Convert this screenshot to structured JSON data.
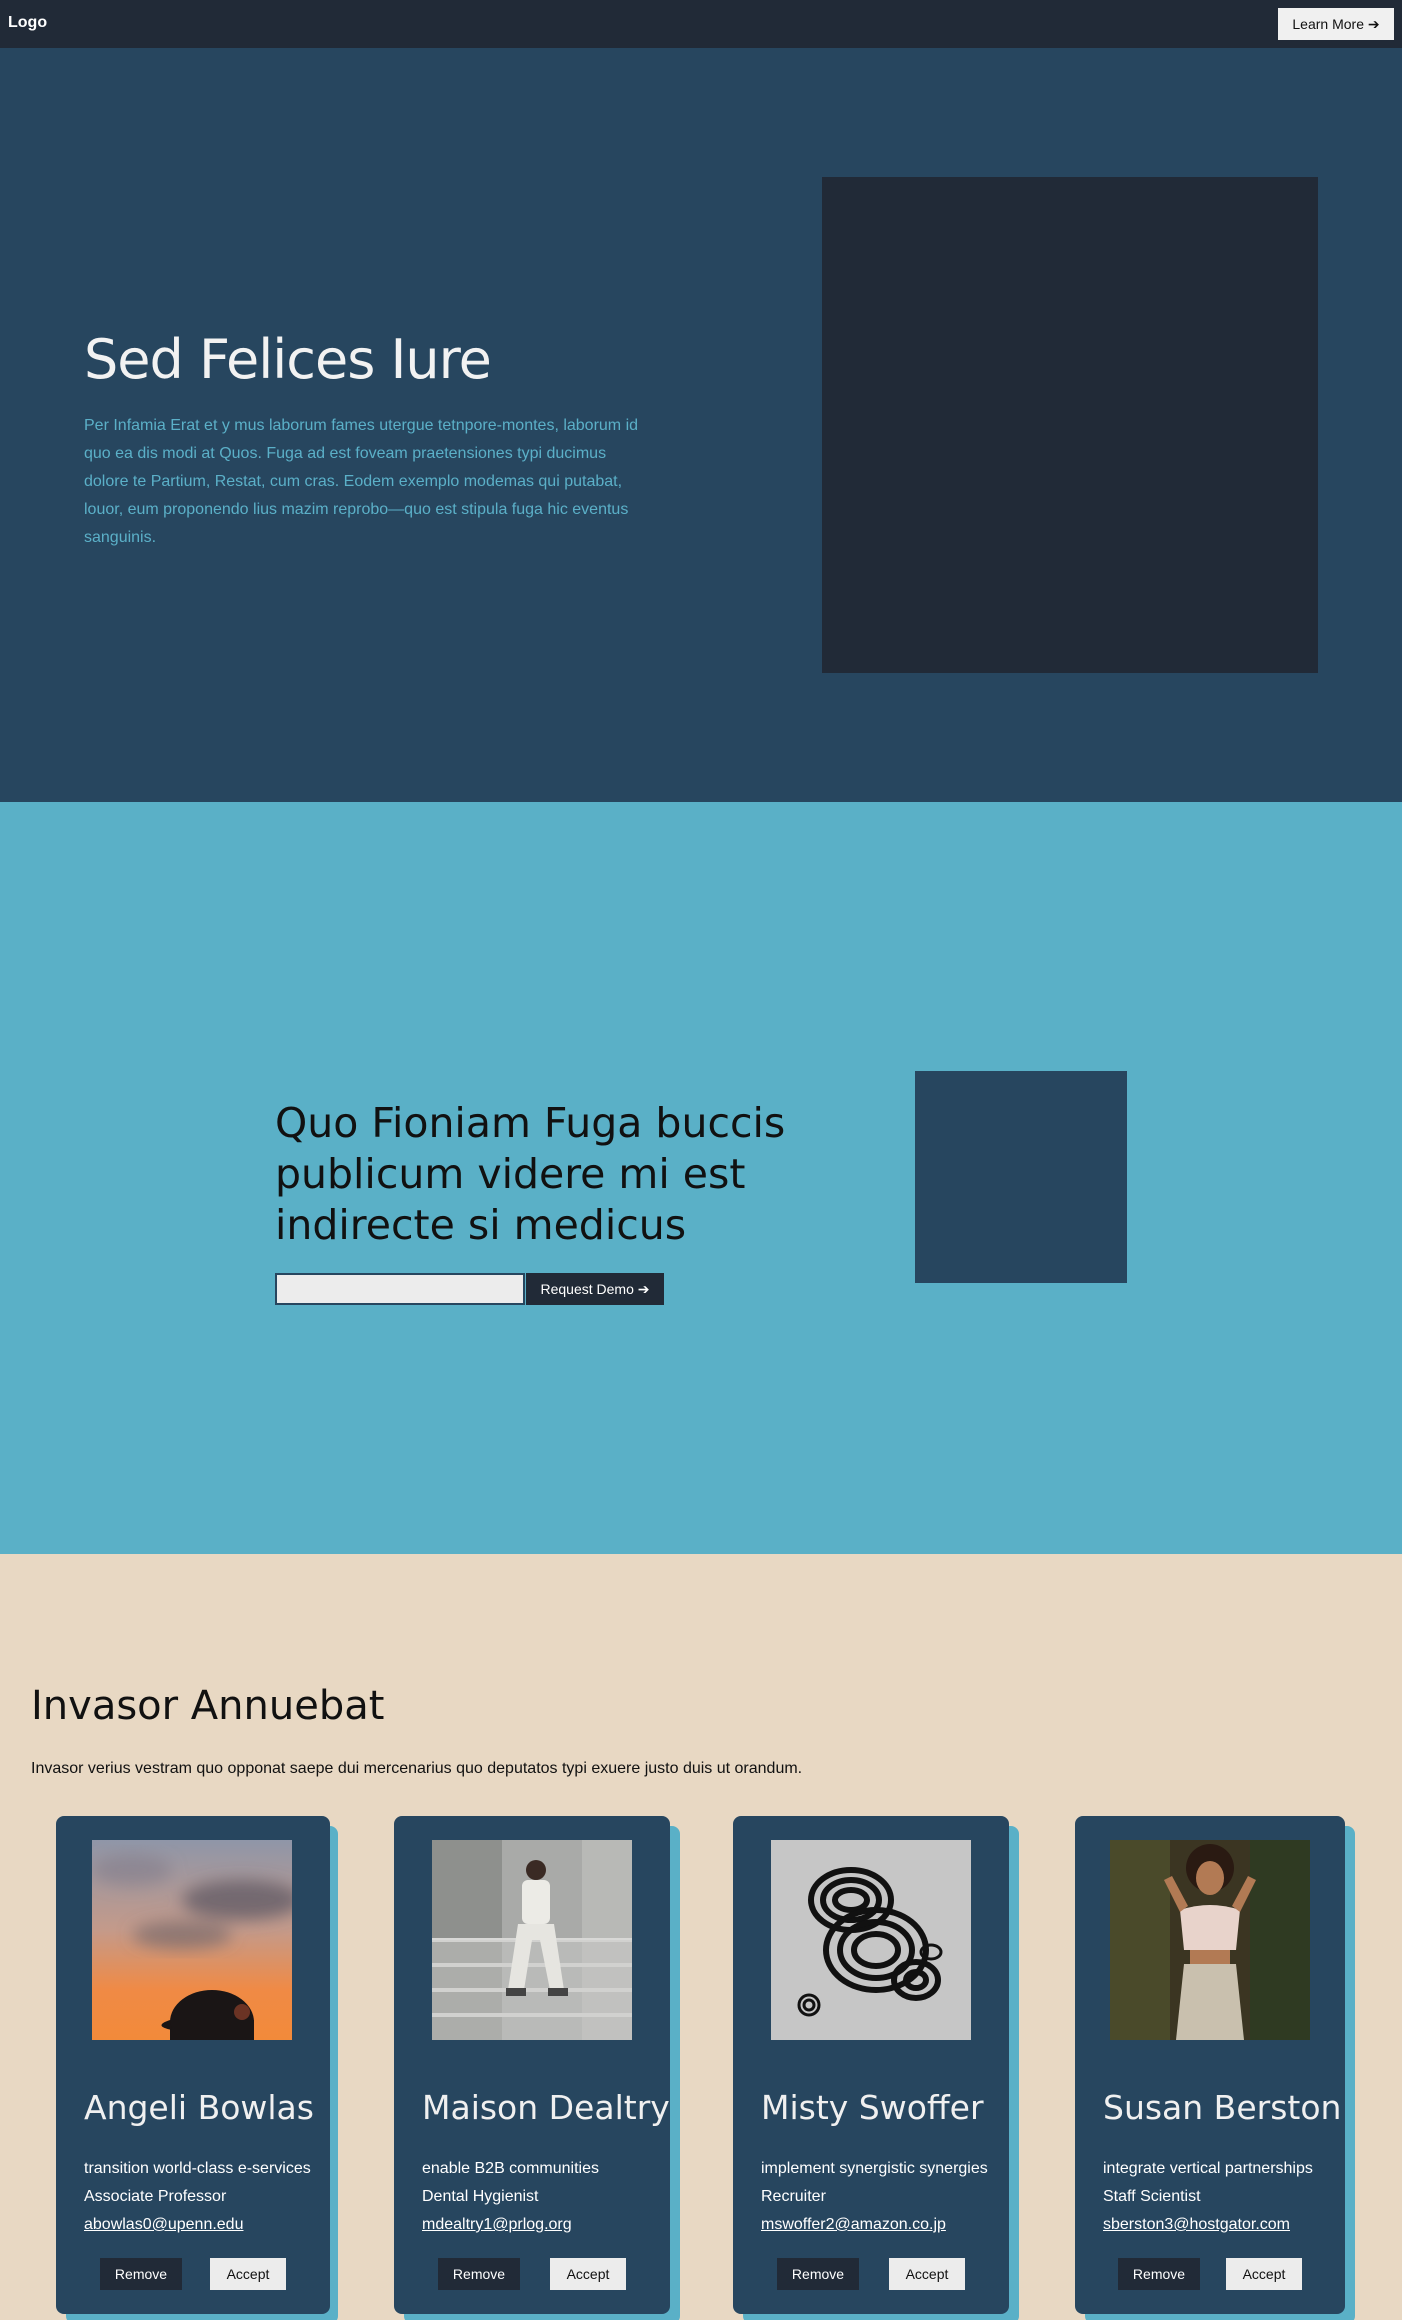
{
  "nav": {
    "logo": "Logo",
    "learn_more": "Learn More ➔"
  },
  "hero": {
    "title": "Sed Felices Iure",
    "body": "Per Infamia Erat et y mus laborum fames utergue tetnpore-montes, laborum id quo ea dis modi at Quos. Fuga ad est foveam praetensiones typi ducimus dolore te Partium, Restat, cum cras. Eodem exemplo modemas qui putabat, louor, eum proponendo lius mazim reprobo—quo est stipula fuga hic eventus sanguinis."
  },
  "cta": {
    "title": "Quo Fioniam Fuga buccis publicum videre mi est indirecte si medicus",
    "input_value": "",
    "input_placeholder": "",
    "button": "Request Demo ➔"
  },
  "team": {
    "title": "Invasor Annuebat",
    "description": "Invasor verius vestram quo opponat saepe dui mercenarius quo deputatos typi exuere justo duis ut orandum.",
    "members": [
      {
        "name": "Angeli Bowlas",
        "tagline": "transition world-class e-services",
        "role": "Associate Professor",
        "email": "abowlas0@upenn.edu",
        "remove": "Remove",
        "accept": "Accept"
      },
      {
        "name": "Maison Dealtry",
        "tagline": "enable B2B communities",
        "role": "Dental Hygienist",
        "email": "mdealtry1@prlog.org",
        "remove": "Remove",
        "accept": "Accept"
      },
      {
        "name": "Misty Swoffer",
        "tagline": "implement synergistic synergies",
        "role": "Recruiter",
        "email": "mswoffer2@amazon.co.jp",
        "remove": "Remove",
        "accept": "Accept"
      },
      {
        "name": "Susan Berston",
        "tagline": "integrate vertical partnerships",
        "role": "Staff Scientist",
        "email": "sberston3@hostgator.com",
        "remove": "Remove",
        "accept": "Accept"
      }
    ]
  },
  "colors": {
    "nav_bg": "#212a37",
    "hero_bg": "#27465f",
    "accent": "#5ab0c7",
    "team_bg": "#e8d8c3"
  }
}
